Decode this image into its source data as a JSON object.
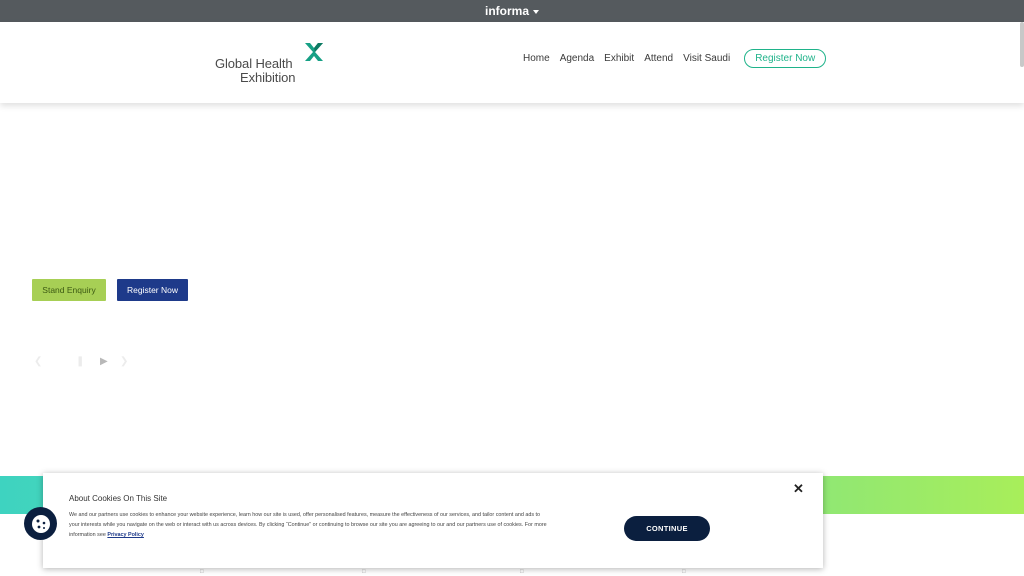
{
  "topbar": {
    "brand": "informa"
  },
  "header": {
    "logo": {
      "line1": "Global Health",
      "line2": "Exhibition"
    },
    "nav": [
      {
        "label": "Home"
      },
      {
        "label": "Agenda"
      },
      {
        "label": "Exhibit"
      },
      {
        "label": "Attend"
      },
      {
        "label": "Visit Saudi"
      }
    ],
    "register_label": "Register Now"
  },
  "hero": {
    "stand_enquiry_label": "Stand Enquiry",
    "register_label": "Register Now"
  },
  "cookie_banner": {
    "title": "About Cookies On This Site",
    "body": "We and our partners use cookies to enhance your website experience, learn how our site is used, offer personalised features, measure the effectiveness of our services, and tailor content and ads to your interests while you navigate on the web or interact with us across devices. By clicking “Continue” or continuing to browse our site you are agreeing to our and our partners use of cookies. For more information see",
    "privacy_link": "Privacy Policy",
    "continue_label": "CONTINUE",
    "close_icon": "close-icon"
  },
  "colors": {
    "topbar": "#555a5e",
    "accent_green": "#1fb38a",
    "stand_button": "#a7cf55",
    "register_button": "#1e3a8a",
    "cookie_button": "#0b1f3f"
  }
}
